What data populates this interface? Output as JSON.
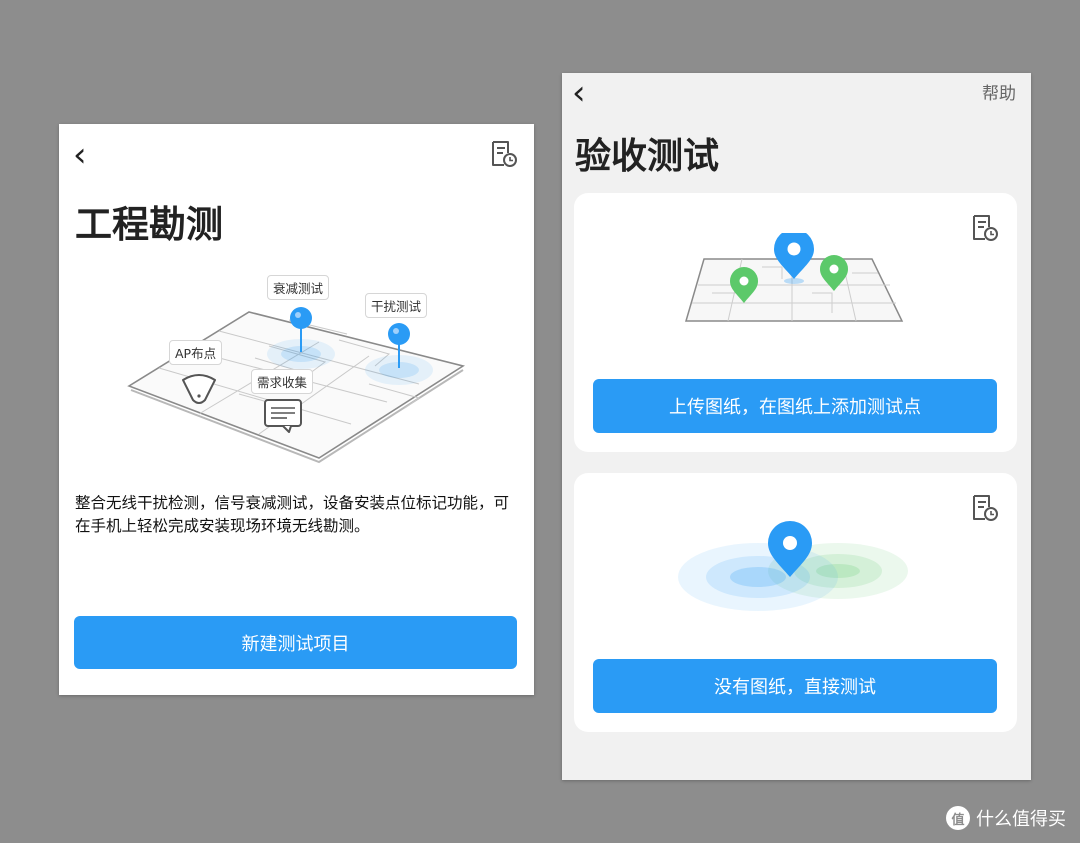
{
  "left_screen": {
    "back_glyph": "‹",
    "title": "工程勘测",
    "callouts": {
      "attenuation": "衰减测试",
      "interference": "干扰测试",
      "ap": "AP布点",
      "requirements": "需求收集"
    },
    "description": "整合无线干扰检测，信号衰减测试，设备安装点位标记功能，可在手机上轻松完成安装现场环境无线勘测。",
    "new_project_button": "新建测试项目"
  },
  "right_screen": {
    "back_glyph": "‹",
    "help_link": "帮助",
    "title": "验收测试",
    "upload_card": {
      "button": "上传图纸，在图纸上添加测试点"
    },
    "direct_card": {
      "button": "没有图纸，直接测试"
    }
  },
  "watermark": {
    "logo": "值",
    "text": "什么值得买"
  },
  "colors": {
    "primary": "#2a9bf5",
    "pin_green": "#5cc96a",
    "background": "#8d8d8d"
  },
  "icons": [
    "back-icon",
    "document-history-icon",
    "location-pin-icon",
    "message-icon",
    "ap-device-icon"
  ]
}
